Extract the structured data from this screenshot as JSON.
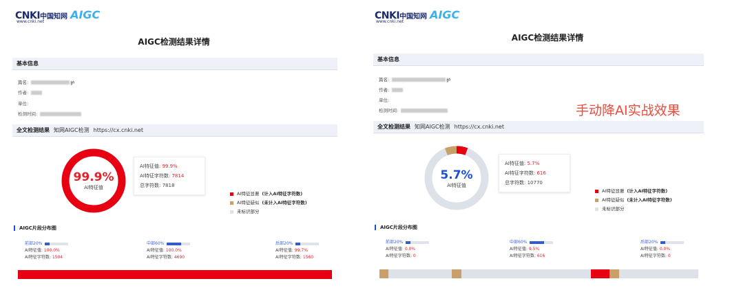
{
  "watermark": "手动降AI实战效果",
  "logo": {
    "cnki": "CNKI",
    "cn": "中国知网",
    "aigc": "AIGC",
    "sub": "www.cnki.net"
  },
  "reports": [
    {
      "title": "AIGC检测结果详情",
      "basic_info": {
        "header": "基本信息",
        "title_label": "篇名:",
        "title_value": "护",
        "author_label": "作者:",
        "unit_label": "单位:",
        "time_label": "检测时间:"
      },
      "fulltext": {
        "header": "全文检测结果",
        "source": "知网AIGC检测",
        "url": "https://cx.cnki.net"
      },
      "score": "99.9%",
      "score_label": "AI特征值",
      "stats": {
        "ai_value_label": "AI特征值:",
        "ai_value": "99.9%",
        "ai_chars_label": "AI特征字符数:",
        "ai_chars": "7814",
        "total_label": "总字符数:",
        "total": "7818"
      },
      "legend": [
        {
          "label": "AI特征显著",
          "note": "(计入AI特征字符数)",
          "color": "red"
        },
        {
          "label": "AI特征疑似",
          "note": "(未计入AI特征字符数)",
          "color": "tan"
        },
        {
          "label": "未标识部分",
          "note": "",
          "color": "gray"
        }
      ],
      "dist_title": "AIGC片段分布图",
      "segments": [
        {
          "label": "前部20%",
          "ai_label": "AI特征值:",
          "ai": "100.0%",
          "chars_label": "AI特征字符数:",
          "chars": "1504",
          "fill": 0.2
        },
        {
          "label": "中部60%",
          "ai_label": "AI特征值:",
          "ai": "100.0%",
          "chars_label": "AI特征字符数:",
          "chars": "4690",
          "fill": 0.6
        },
        {
          "label": "后部20%",
          "ai_label": "AI特征值:",
          "ai": "99.7%",
          "chars_label": "AI特征字符数:",
          "chars": "1560",
          "fill": 0.2
        }
      ],
      "ring": {
        "red": 0.999,
        "tan": 0.0
      }
    },
    {
      "title": "AIGC检测结果详情",
      "basic_info": {
        "header": "基本信息",
        "title_label": "篇名:",
        "title_value": "护",
        "author_label": "作者:",
        "unit_label": "单位:",
        "time_label": "检测时间:"
      },
      "fulltext": {
        "header": "全文检测结果",
        "source": "知网AIGC检测",
        "url": "https://cx.cnki.net"
      },
      "score": "5.7%",
      "score_label": "AI特征值",
      "stats": {
        "ai_value_label": "AI特征值:",
        "ai_value": "5.7%",
        "ai_chars_label": "AI特征字符数:",
        "ai_chars": "616",
        "total_label": "总字符数:",
        "total": "10770"
      },
      "legend": [
        {
          "label": "AI特征显著",
          "note": "(计入AI特征字符数)",
          "color": "red"
        },
        {
          "label": "AI特征疑似",
          "note": "(未计入AI特征字符数)",
          "color": "tan"
        },
        {
          "label": "未标识部分",
          "note": "",
          "color": "gray"
        }
      ],
      "dist_title": "AIGC片段分布图",
      "segments": [
        {
          "label": "前部20%",
          "ai_label": "AI特征值:",
          "ai": "0.0%",
          "chars_label": "AI特征字符数:",
          "chars": "0",
          "fill": 0.2
        },
        {
          "label": "中部60%",
          "ai_label": "AI特征值:",
          "ai": "9.5%",
          "chars_label": "AI特征字符数:",
          "chars": "616",
          "fill": 0.6
        },
        {
          "label": "后部20%",
          "ai_label": "AI特征值:",
          "ai": "0.0%",
          "chars_label": "AI特征字符数:",
          "chars": "0",
          "fill": 0.2
        }
      ],
      "ring": {
        "red": 0.057,
        "tan": 0.06
      }
    }
  ],
  "colors": {
    "red": "#e60012",
    "tan": "#c9a06a",
    "gray": "#dde1e8",
    "blue": "#2f5bd9"
  }
}
